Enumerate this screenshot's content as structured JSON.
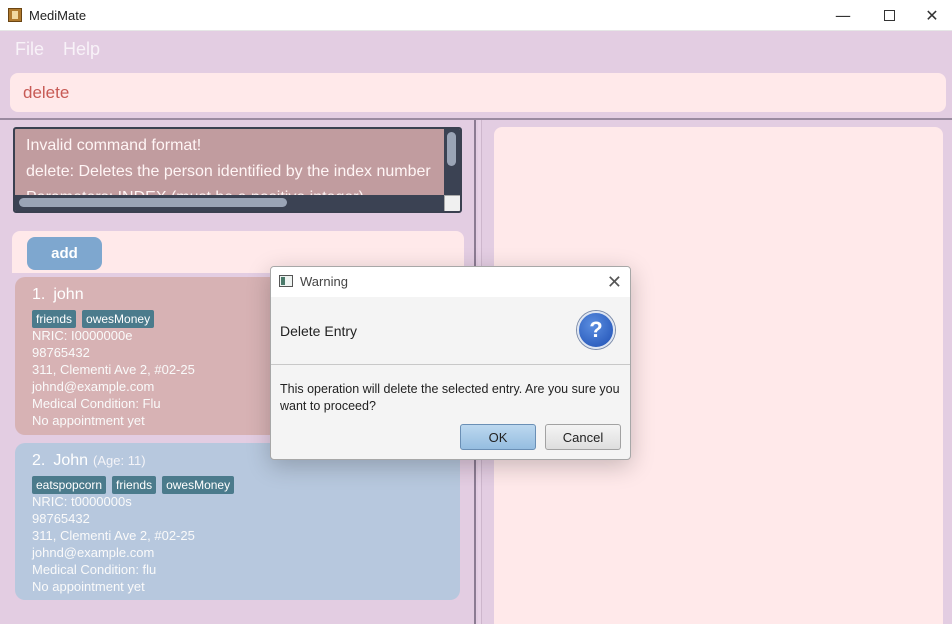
{
  "window": {
    "title": "MediMate",
    "minimize_glyph": "—",
    "close_glyph": "✕"
  },
  "menu": {
    "items": [
      "File",
      "Help"
    ]
  },
  "command": {
    "value": "delete"
  },
  "result": {
    "lines": [
      "Invalid command format!",
      "delete: Deletes the person identified by the index number",
      "Parameters: INDEX (must be a positive integer)"
    ]
  },
  "list": {
    "add_label": "add",
    "persons": [
      {
        "index": "1.",
        "name": "john",
        "age": "",
        "tags": [
          "friends",
          "owesMoney"
        ],
        "nric": "NRIC: I0000000e",
        "phone": "98765432",
        "address": "311, Clementi Ave 2, #02-25",
        "email": "johnd@example.com",
        "condition": "Medical Condition: Flu",
        "appointment": "No appointment yet"
      },
      {
        "index": "2.",
        "name": "John",
        "age": "(Age: 11)",
        "tags": [
          "eatspopcorn",
          "friends",
          "owesMoney"
        ],
        "nric": "NRIC: t0000000s",
        "phone": "98765432",
        "address": "311, Clementi Ave 2, #02-25",
        "email": "johnd@example.com",
        "condition": "Medical Condition: flu",
        "appointment": "No appointment yet"
      }
    ]
  },
  "dialog": {
    "title": "Warning",
    "close_glyph": "✕",
    "header": "Delete Entry",
    "icon": "question-icon",
    "icon_glyph": "?",
    "content": "This operation will delete the selected entry. Are you sure you want to proceed?",
    "ok_label": "OK",
    "cancel_label": "Cancel"
  },
  "colors": {
    "background": "#e3cde2",
    "panel": "#ffe9ea",
    "card_selected": "#d7b2b4",
    "card_default": "#b7c8de",
    "tag": "#4b7b8c",
    "add_button": "#7ea7cf",
    "command_text": "#c75a55"
  }
}
